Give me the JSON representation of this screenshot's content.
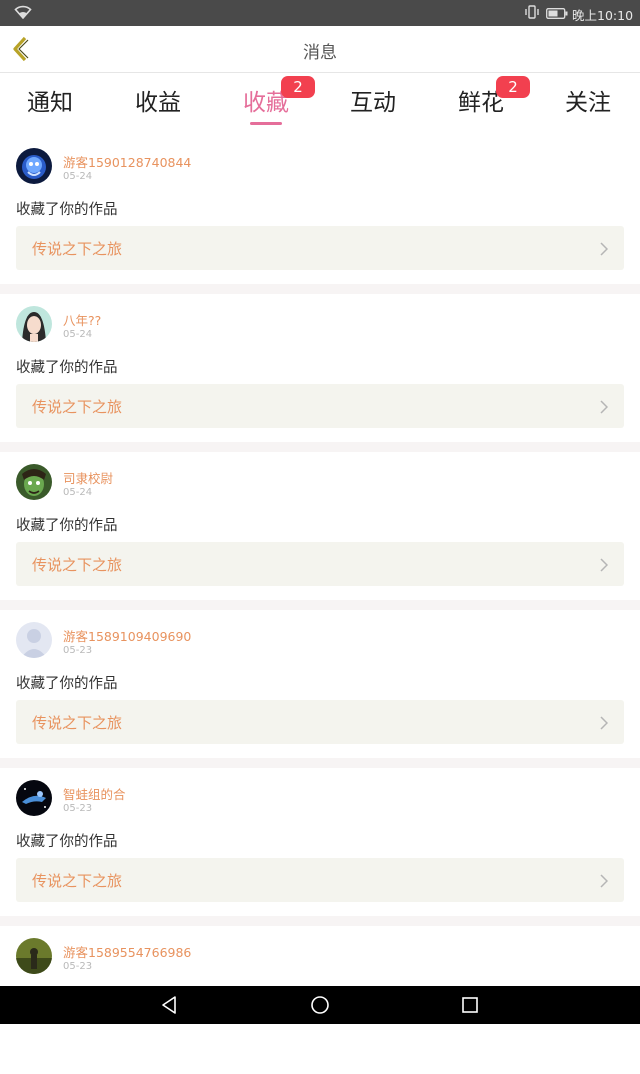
{
  "status_bar": {
    "time": "晚上10:10"
  },
  "header": {
    "title": "消息"
  },
  "tabs": [
    {
      "label": "通知",
      "badge": ""
    },
    {
      "label": "收益",
      "badge": ""
    },
    {
      "label": "收藏",
      "badge": "2",
      "active": true
    },
    {
      "label": "互动",
      "badge": ""
    },
    {
      "label": "鲜花",
      "badge": "2"
    },
    {
      "label": "关注",
      "badge": ""
    }
  ],
  "items": [
    {
      "username": "游客1590128740844",
      "date": "05-24",
      "action": "收藏了你的作品",
      "work_title": "传说之下之旅",
      "avatar": "blue-creature-avatar"
    },
    {
      "username": "八年??",
      "date": "05-24",
      "action": "收藏了你的作品",
      "work_title": "传说之下之旅",
      "avatar": "anime-girl-avatar"
    },
    {
      "username": "司隶校尉",
      "date": "05-24",
      "action": "收藏了你的作品",
      "work_title": "传说之下之旅",
      "avatar": "green-elf-avatar"
    },
    {
      "username": "游客1589109409690",
      "date": "05-23",
      "action": "收藏了你的作品",
      "work_title": "传说之下之旅",
      "avatar": "default-person-avatar"
    },
    {
      "username": "智蛙组的合",
      "date": "05-23",
      "action": "收藏了你的作品",
      "work_title": "传说之下之旅",
      "avatar": "dark-space-avatar"
    },
    {
      "username": "游客1589554766986",
      "date": "05-23",
      "action": "",
      "work_title": "",
      "avatar": "forest-figure-avatar"
    }
  ]
}
